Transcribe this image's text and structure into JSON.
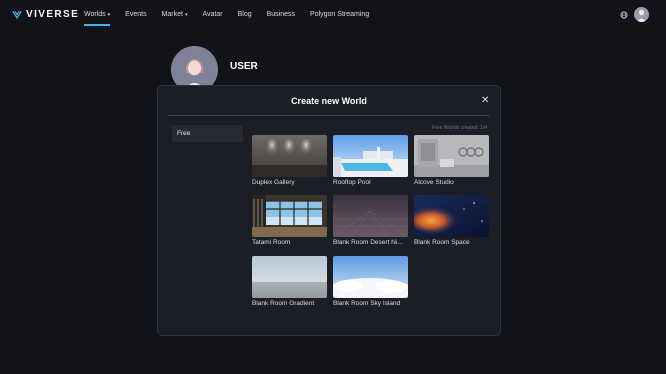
{
  "nav": {
    "logo_text": "VIVERSE",
    "items": [
      {
        "label": "Worlds",
        "has_caret": true,
        "active": true
      },
      {
        "label": "Events",
        "has_caret": false,
        "active": false
      },
      {
        "label": "Market",
        "has_caret": true,
        "active": false
      },
      {
        "label": "Avatar",
        "has_caret": false,
        "active": false
      },
      {
        "label": "Blog",
        "has_caret": false,
        "active": false
      },
      {
        "label": "Business",
        "has_caret": false,
        "active": false
      },
      {
        "label": "Polygon Streaming",
        "has_caret": false,
        "active": false
      }
    ],
    "right_icons": [
      "globe-icon",
      "user-avatar"
    ]
  },
  "profile": {
    "name": "USER"
  },
  "modal": {
    "title": "Create new World",
    "close_icon": "close-icon",
    "tabs": [
      {
        "label": "Free",
        "selected": true
      }
    ],
    "created_note": "Free Worlds created: 1/4",
    "worlds": [
      {
        "label": "Duplex Gallery"
      },
      {
        "label": "Rooftop Pool"
      },
      {
        "label": "Alcove Studio"
      },
      {
        "label": "Tatami Room"
      },
      {
        "label": "Blank Room Desert Ni..."
      },
      {
        "label": "Blank Room Space"
      },
      {
        "label": "Blank Room Gradient"
      },
      {
        "label": "Blank Room Sky Island"
      }
    ]
  },
  "colors": {
    "accent": "#3fb4e8",
    "background": "#121318",
    "modal_bg": "#1c1e25"
  }
}
